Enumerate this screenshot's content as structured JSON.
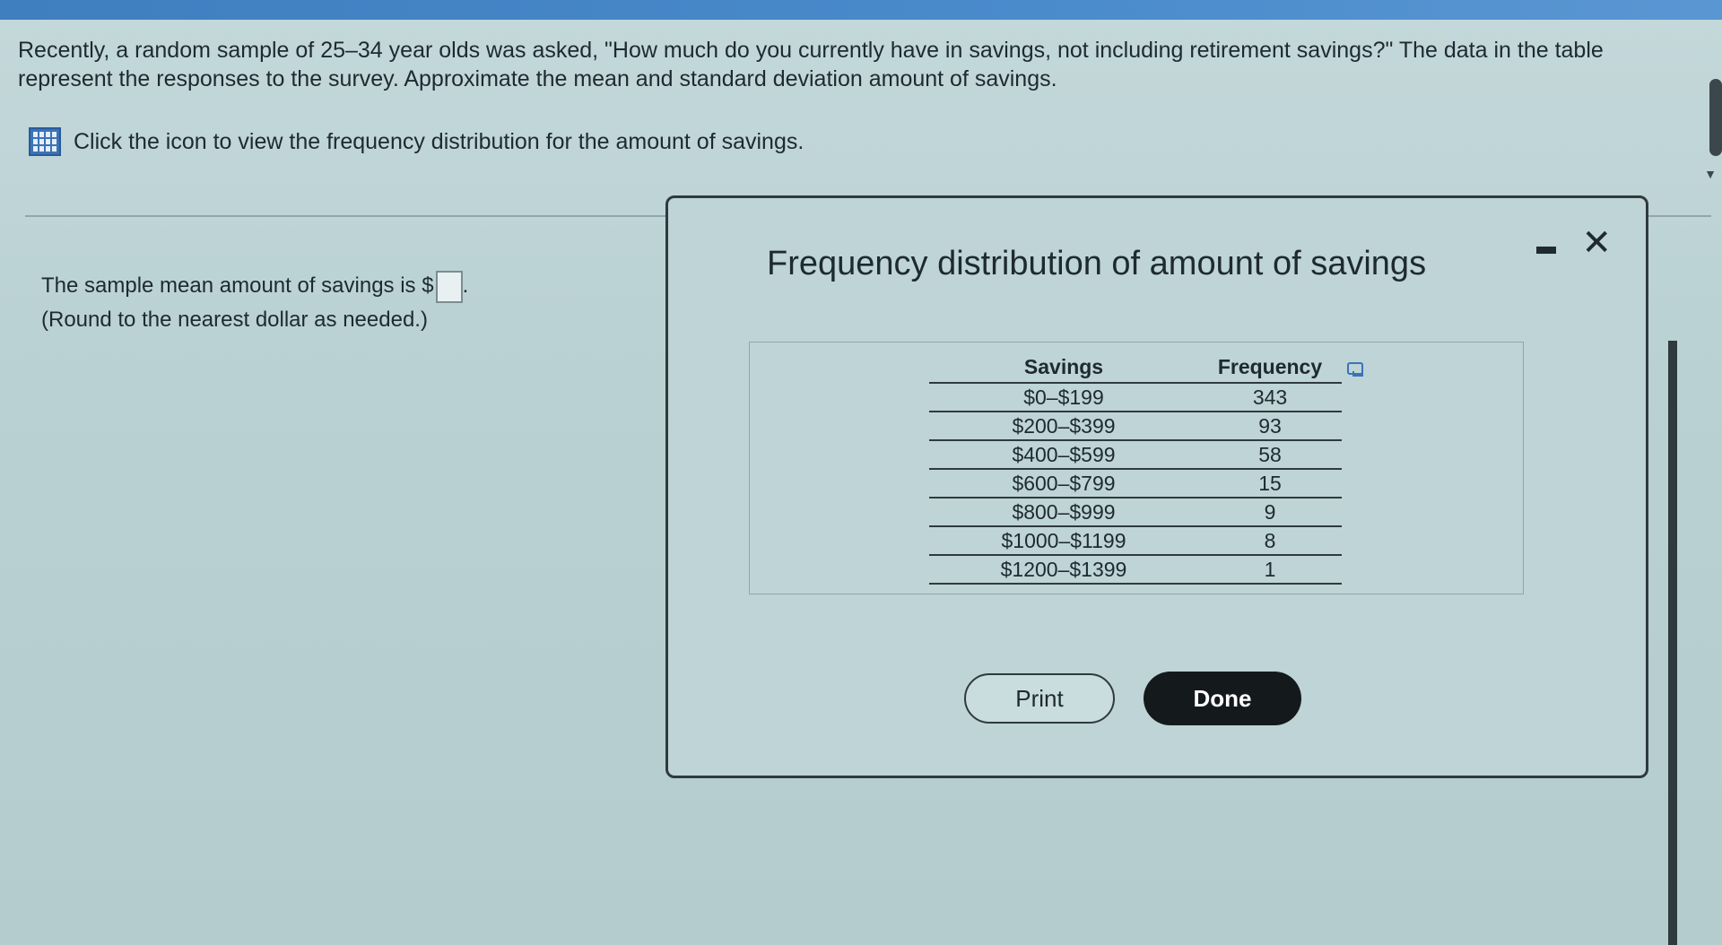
{
  "question": {
    "text": "Recently, a random sample of 25–34 year olds was asked, \"How much do you currently have in savings, not including retirement savings?\" The data in the table represent the responses to the survey. Approximate the mean and standard deviation amount of savings."
  },
  "prompt_link": {
    "icon": "table-grid-icon",
    "text": "Click the icon to view the frequency distribution for the amount of savings."
  },
  "answer": {
    "prefix": "The sample mean amount of savings is $",
    "suffix": ".",
    "note": "(Round to the nearest dollar as needed.)",
    "value": ""
  },
  "dialog": {
    "title": "Frequency distribution of amount of savings",
    "minimize_icon": "minimize-icon",
    "close_icon": "close-icon",
    "close_glyph": "✕",
    "table": {
      "headers": [
        "Savings",
        "Frequency"
      ],
      "rows": [
        [
          "$0–$199",
          "343"
        ],
        [
          "$200–$399",
          "93"
        ],
        [
          "$400–$599",
          "58"
        ],
        [
          "$600–$799",
          "15"
        ],
        [
          "$800–$999",
          "9"
        ],
        [
          "$1000–$1199",
          "8"
        ],
        [
          "$1200–$1399",
          "1"
        ]
      ]
    },
    "print_label": "Print",
    "done_label": "Done"
  },
  "colors": {
    "accent": "#3a73b8",
    "background": "#bed4d6",
    "done_button": "#141a1c"
  }
}
